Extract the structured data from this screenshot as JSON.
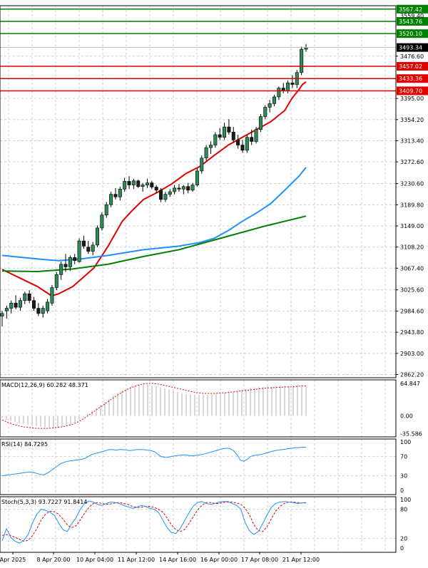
{
  "chart_data": {
    "type": "candlestick",
    "main": {
      "y_ticks": [
        "3476.60",
        "3395.00",
        "3354.20",
        "3313.40",
        "3272.60",
        "3230.60",
        "3189.80",
        "3149.00",
        "3108.20",
        "3067.40",
        "3025.60",
        "2984.60",
        "2943.80",
        "2903.00",
        "2862.20"
      ],
      "y_ticks_values": [
        3476.6,
        3395.0,
        3354.2,
        3313.4,
        3272.6,
        3230.6,
        3189.8,
        3149.0,
        3108.2,
        3067.4,
        3025.6,
        2984.6,
        2943.8,
        2903.0,
        2862.2
      ],
      "ylim": [
        2856,
        3574
      ],
      "top_partial_label": "3559.40",
      "current_price": {
        "value": 3493.34,
        "label": "3493.34"
      },
      "levels": [
        {
          "value": 3567.42,
          "label": "3567.42",
          "color": "#008000"
        },
        {
          "value": 3543.76,
          "label": "3543.76",
          "color": "#008000"
        },
        {
          "value": 3520.1,
          "label": "3520.10",
          "color": "#008000"
        },
        {
          "value": 3457.02,
          "label": "3457.02",
          "color": "#e00000"
        },
        {
          "value": 3433.36,
          "label": "3433.36",
          "color": "#e00000"
        },
        {
          "value": 3409.7,
          "label": "3409.70",
          "color": "#e00000"
        }
      ],
      "candles": [
        {
          "o": 2975,
          "h": 2985,
          "l": 2955,
          "c": 2980
        },
        {
          "o": 2985,
          "h": 2995,
          "l": 2970,
          "c": 2990
        },
        {
          "o": 2990,
          "h": 3005,
          "l": 2980,
          "c": 3000
        },
        {
          "o": 3000,
          "h": 3015,
          "l": 2988,
          "c": 2992
        },
        {
          "o": 2992,
          "h": 3010,
          "l": 2985,
          "c": 3005
        },
        {
          "o": 3005,
          "h": 3022,
          "l": 2998,
          "c": 3018
        },
        {
          "o": 3018,
          "h": 3025,
          "l": 3000,
          "c": 3005
        },
        {
          "o": 3005,
          "h": 3012,
          "l": 2985,
          "c": 2990
        },
        {
          "o": 2990,
          "h": 3000,
          "l": 2975,
          "c": 2980
        },
        {
          "o": 2980,
          "h": 2995,
          "l": 2972,
          "c": 2990
        },
        {
          "o": 2985,
          "h": 3008,
          "l": 2980,
          "c": 3002
        },
        {
          "o": 3000,
          "h": 3035,
          "l": 2995,
          "c": 3030
        },
        {
          "o": 3030,
          "h": 3060,
          "l": 3025,
          "c": 3055
        },
        {
          "o": 3055,
          "h": 3080,
          "l": 3045,
          "c": 3075
        },
        {
          "o": 3075,
          "h": 3095,
          "l": 3060,
          "c": 3070
        },
        {
          "o": 3070,
          "h": 3092,
          "l": 3062,
          "c": 3088
        },
        {
          "o": 3088,
          "h": 3095,
          "l": 3075,
          "c": 3082
        },
        {
          "o": 3080,
          "h": 3125,
          "l": 3078,
          "c": 3120
        },
        {
          "o": 3120,
          "h": 3130,
          "l": 3105,
          "c": 3110
        },
        {
          "o": 3108,
          "h": 3120,
          "l": 3095,
          "c": 3100
        },
        {
          "o": 3100,
          "h": 3118,
          "l": 3092,
          "c": 3112
        },
        {
          "o": 3112,
          "h": 3150,
          "l": 3108,
          "c": 3145
        },
        {
          "o": 3145,
          "h": 3175,
          "l": 3140,
          "c": 3170
        },
        {
          "o": 3170,
          "h": 3195,
          "l": 3165,
          "c": 3190
        },
        {
          "o": 3190,
          "h": 3215,
          "l": 3185,
          "c": 3210
        },
        {
          "o": 3210,
          "h": 3222,
          "l": 3200,
          "c": 3205
        },
        {
          "o": 3205,
          "h": 3225,
          "l": 3198,
          "c": 3220
        },
        {
          "o": 3220,
          "h": 3242,
          "l": 3215,
          "c": 3235
        },
        {
          "o": 3235,
          "h": 3245,
          "l": 3220,
          "c": 3228
        },
        {
          "o": 3228,
          "h": 3240,
          "l": 3220,
          "c": 3236
        },
        {
          "o": 3236,
          "h": 3238,
          "l": 3222,
          "c": 3225
        },
        {
          "o": 3225,
          "h": 3232,
          "l": 3215,
          "c": 3228
        },
        {
          "o": 3228,
          "h": 3240,
          "l": 3222,
          "c": 3232
        },
        {
          "o": 3232,
          "h": 3236,
          "l": 3220,
          "c": 3224
        },
        {
          "o": 3224,
          "h": 3228,
          "l": 3212,
          "c": 3218
        },
        {
          "o": 3218,
          "h": 3222,
          "l": 3195,
          "c": 3200
        },
        {
          "o": 3200,
          "h": 3215,
          "l": 3195,
          "c": 3210
        },
        {
          "o": 3210,
          "h": 3220,
          "l": 3205,
          "c": 3215
        },
        {
          "o": 3215,
          "h": 3228,
          "l": 3210,
          "c": 3222
        },
        {
          "o": 3222,
          "h": 3230,
          "l": 3215,
          "c": 3220
        },
        {
          "o": 3220,
          "h": 3228,
          "l": 3210,
          "c": 3225
        },
        {
          "o": 3225,
          "h": 3232,
          "l": 3212,
          "c": 3218
        },
        {
          "o": 3218,
          "h": 3232,
          "l": 3215,
          "c": 3228
        },
        {
          "o": 3228,
          "h": 3260,
          "l": 3225,
          "c": 3255
        },
        {
          "o": 3255,
          "h": 3285,
          "l": 3250,
          "c": 3280
        },
        {
          "o": 3280,
          "h": 3305,
          "l": 3275,
          "c": 3300
        },
        {
          "o": 3300,
          "h": 3312,
          "l": 3288,
          "c": 3305
        },
        {
          "o": 3305,
          "h": 3330,
          "l": 3300,
          "c": 3325
        },
        {
          "o": 3325,
          "h": 3338,
          "l": 3315,
          "c": 3320
        },
        {
          "o": 3320,
          "h": 3348,
          "l": 3315,
          "c": 3340
        },
        {
          "o": 3340,
          "h": 3355,
          "l": 3325,
          "c": 3330
        },
        {
          "o": 3330,
          "h": 3340,
          "l": 3310,
          "c": 3315
        },
        {
          "o": 3315,
          "h": 3325,
          "l": 3298,
          "c": 3305
        },
        {
          "o": 3305,
          "h": 3315,
          "l": 3290,
          "c": 3295
        },
        {
          "o": 3295,
          "h": 3325,
          "l": 3290,
          "c": 3320
        },
        {
          "o": 3320,
          "h": 3335,
          "l": 3305,
          "c": 3312
        },
        {
          "o": 3312,
          "h": 3340,
          "l": 3308,
          "c": 3335
        },
        {
          "o": 3335,
          "h": 3365,
          "l": 3330,
          "c": 3360
        },
        {
          "o": 3360,
          "h": 3382,
          "l": 3355,
          "c": 3378
        },
        {
          "o": 3378,
          "h": 3392,
          "l": 3368,
          "c": 3385
        },
        {
          "o": 3385,
          "h": 3402,
          "l": 3380,
          "c": 3398
        },
        {
          "o": 3398,
          "h": 3418,
          "l": 3392,
          "c": 3415
        },
        {
          "o": 3415,
          "h": 3425,
          "l": 3405,
          "c": 3410
        },
        {
          "o": 3410,
          "h": 3430,
          "l": 3405,
          "c": 3425
        },
        {
          "o": 3425,
          "h": 3440,
          "l": 3415,
          "c": 3422
        },
        {
          "o": 3422,
          "h": 3450,
          "l": 3415,
          "c": 3445
        },
        {
          "o": 3445,
          "h": 3495,
          "l": 3440,
          "c": 3490
        },
        {
          "o": 3490,
          "h": 3500,
          "l": 3485,
          "c": 3493
        }
      ],
      "moving_averages": [
        {
          "color": "#e00000",
          "values": [
            [
              0,
              3065
            ],
            [
              10,
              3032
            ],
            [
              14,
              3014
            ],
            [
              16,
              3018
            ],
            [
              20,
              3032
            ],
            [
              26,
              3068
            ],
            [
              30,
              3110
            ],
            [
              34,
              3158
            ],
            [
              37,
              3180
            ],
            [
              40,
              3200
            ],
            [
              44,
              3214
            ],
            [
              48,
              3230
            ],
            [
              52,
              3250
            ],
            [
              56,
              3264
            ],
            [
              60,
              3285
            ],
            [
              64,
              3305
            ],
            [
              68,
              3320
            ],
            [
              72,
              3335
            ],
            [
              76,
              3350
            ],
            [
              80,
              3372
            ],
            [
              82,
              3395
            ],
            [
              84,
              3412
            ],
            [
              85,
              3422
            ],
            [
              86,
              3427
            ]
          ]
        },
        {
          "color": "#1e90ff",
          "values": [
            [
              0,
              3092
            ],
            [
              6,
              3088
            ],
            [
              12,
              3084
            ],
            [
              16,
              3082
            ],
            [
              22,
              3085
            ],
            [
              30,
              3092
            ],
            [
              40,
              3103
            ],
            [
              50,
              3110
            ],
            [
              56,
              3117
            ],
            [
              60,
              3125
            ],
            [
              64,
              3140
            ],
            [
              68,
              3158
            ],
            [
              72,
              3174
            ],
            [
              76,
              3192
            ],
            [
              80,
              3218
            ],
            [
              84,
              3245
            ],
            [
              86,
              3262
            ]
          ]
        },
        {
          "color": "#008000",
          "values": [
            [
              0,
              3062
            ],
            [
              10,
              3061
            ],
            [
              20,
              3066
            ],
            [
              30,
              3075
            ],
            [
              40,
              3090
            ],
            [
              50,
              3103
            ],
            [
              58,
              3118
            ],
            [
              66,
              3133
            ],
            [
              74,
              3148
            ],
            [
              80,
              3158
            ],
            [
              86,
              3168
            ]
          ]
        }
      ]
    },
    "macd": {
      "label": "MACD(12,26,9) 60.282 48.371",
      "y_ticks": [
        "64.847",
        "0.00",
        "-35.586"
      ],
      "ylim": [
        -42,
        72
      ],
      "histogram": [
        -4,
        -8,
        -10,
        -12,
        -14,
        -16,
        -18,
        -20,
        -21,
        -22,
        -23,
        -24,
        -24,
        -24,
        -22,
        -20,
        -18,
        -14,
        -8,
        -2,
        4,
        10,
        16,
        22,
        28,
        34,
        40,
        46,
        51,
        55,
        58,
        60,
        62,
        63,
        63,
        61,
        59,
        57,
        55,
        53,
        50,
        48,
        45,
        44,
        43,
        42,
        42,
        42,
        42,
        43,
        44,
        45,
        46,
        47,
        48,
        50,
        52,
        54,
        56,
        57,
        58,
        58,
        59,
        59,
        60,
        61,
        60,
        60,
        61,
        62,
        61,
        60
      ],
      "signal": [
        -8,
        -12,
        -15,
        -18,
        -20,
        -22,
        -23,
        -24,
        -25,
        -25,
        -25,
        -25,
        -24,
        -23,
        -22,
        -20,
        -18,
        -15,
        -11,
        -6,
        0,
        6,
        12,
        18,
        24,
        30,
        36,
        42,
        47,
        52,
        56,
        59,
        62,
        64,
        65,
        65,
        64,
        63,
        61,
        59,
        57,
        55,
        53,
        51,
        49,
        47,
        46,
        45,
        45,
        45,
        45,
        46,
        46,
        47,
        48,
        49,
        50,
        51,
        52,
        53,
        54,
        55,
        56,
        56,
        57,
        57,
        58,
        58,
        58,
        59,
        60,
        60
      ]
    },
    "rsi": {
      "label": "RSI(14) 84.7295",
      "y_ticks": [
        "100",
        "70",
        "30",
        "0"
      ],
      "ylim": [
        0,
        100
      ],
      "values": [
        30,
        31,
        32,
        33,
        34,
        35,
        36,
        37,
        38,
        37,
        35,
        33,
        32,
        35,
        40,
        45,
        50,
        55,
        58,
        60,
        61,
        62,
        63,
        64,
        66,
        70,
        74,
        76,
        78,
        80,
        82,
        84,
        84,
        83,
        84,
        84,
        83,
        82,
        83,
        84,
        84,
        84,
        83,
        82,
        80,
        75,
        70,
        68,
        68,
        70,
        71,
        72,
        73,
        73,
        72,
        71,
        72,
        73,
        74,
        76,
        78,
        80,
        82,
        84,
        86,
        87,
        86,
        82,
        74,
        62,
        60,
        64,
        70,
        72,
        73,
        74,
        76,
        78,
        80,
        82,
        83,
        84,
        85,
        86,
        87,
        88,
        88,
        89,
        89
      ]
    },
    "stoch": {
      "label": "Stoch(5,3,3) 93.7227 91.8414",
      "y_ticks": [
        "100",
        "80",
        "20",
        "0"
      ],
      "ylim": [
        0,
        100
      ],
      "k": [
        15,
        40,
        22,
        14,
        10,
        16,
        28,
        52,
        70,
        80,
        78,
        74,
        68,
        52,
        38,
        34,
        50,
        62,
        80,
        92,
        97,
        95,
        90,
        88,
        92,
        95,
        94,
        92,
        88,
        85,
        82,
        84,
        88,
        86,
        82,
        80,
        74,
        58,
        42,
        32,
        30,
        40,
        56,
        72,
        86,
        94,
        96,
        92,
        90,
        92,
        95,
        96,
        96,
        92,
        88,
        80,
        52,
        35,
        28,
        34,
        50,
        68,
        84,
        92,
        95,
        96,
        95,
        94,
        92,
        93,
        94
      ],
      "d": [
        26,
        28,
        26,
        22,
        18,
        14,
        16,
        26,
        40,
        58,
        70,
        76,
        75,
        70,
        60,
        48,
        42,
        46,
        58,
        72,
        84,
        92,
        94,
        92,
        90,
        91,
        93,
        94,
        92,
        90,
        86,
        84,
        84,
        86,
        86,
        84,
        80,
        74,
        62,
        48,
        38,
        34,
        38,
        50,
        64,
        78,
        88,
        94,
        94,
        92,
        92,
        94,
        95,
        95,
        93,
        90,
        82,
        68,
        48,
        36,
        34,
        44,
        60,
        76,
        86,
        92,
        95,
        95,
        94,
        93,
        93
      ]
    },
    "x_labels": [
      "Apr 2025",
      "8 Apr 20:00",
      "10 Apr 04:00",
      "11 Apr 12:00",
      "14 Apr 16:00",
      "16 Apr 00:00",
      "17 Apr 08:00",
      "21 Apr 12:00"
    ]
  }
}
